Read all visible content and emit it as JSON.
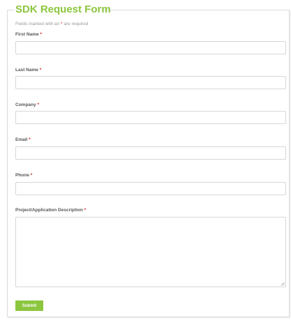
{
  "form": {
    "title": "SDK Request Form",
    "required_note_prefix": "Fields marked with an ",
    "required_note_star": "*",
    "required_note_suffix": " are required",
    "required_marker": "*",
    "fields": [
      {
        "label": "First Name",
        "value": "",
        "placeholder": ""
      },
      {
        "label": "Last Name",
        "value": "",
        "placeholder": ""
      },
      {
        "label": "Company",
        "value": "",
        "placeholder": ""
      },
      {
        "label": "Email",
        "value": "",
        "placeholder": ""
      },
      {
        "label": "Phone",
        "value": "",
        "placeholder": ""
      }
    ],
    "description": {
      "label": "Project/Application Description",
      "value": "",
      "placeholder": ""
    },
    "submit_label": "Submit"
  },
  "colors": {
    "accent": "#8cc63f",
    "required": "#cc2222",
    "label": "#555555",
    "border": "#d6d6d6"
  }
}
